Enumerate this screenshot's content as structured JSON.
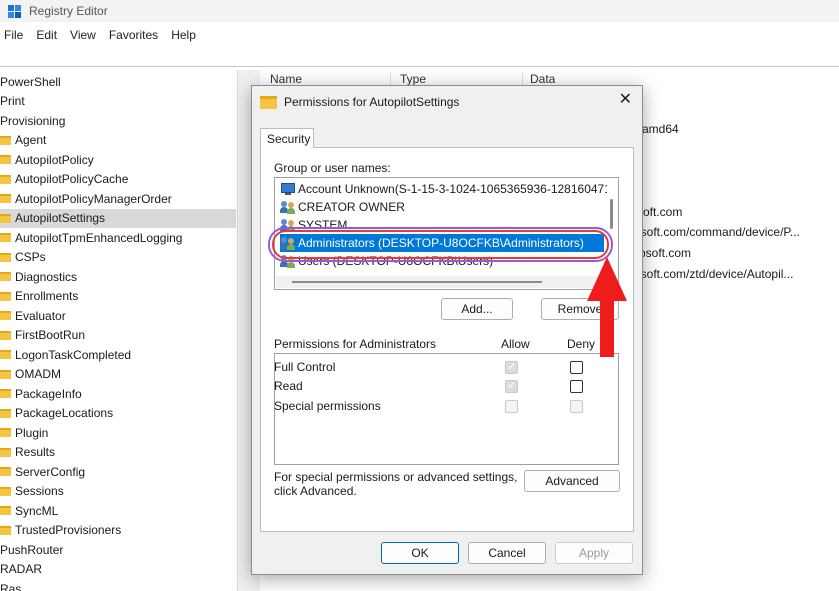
{
  "window": {
    "title": "Registry Editor"
  },
  "menu": [
    "File",
    "Edit",
    "View",
    "Favorites",
    "Help"
  ],
  "tree": {
    "items": [
      {
        "label": "PowerShell",
        "folder": false
      },
      {
        "label": "Print",
        "folder": false
      },
      {
        "label": "Provisioning",
        "folder": false
      },
      {
        "label": "Agent",
        "folder": true
      },
      {
        "label": "AutopilotPolicy",
        "folder": true
      },
      {
        "label": "AutopilotPolicyCache",
        "folder": true
      },
      {
        "label": "AutopilotPolicyManagerOrder",
        "folder": true
      },
      {
        "label": "AutopilotSettings",
        "folder": true,
        "selected": true
      },
      {
        "label": "AutopilotTpmEnhancedLogging",
        "folder": true
      },
      {
        "label": "CSPs",
        "folder": true
      },
      {
        "label": "Diagnostics",
        "folder": true
      },
      {
        "label": "Enrollments",
        "folder": true
      },
      {
        "label": "Evaluator",
        "folder": true
      },
      {
        "label": "FirstBootRun",
        "folder": true
      },
      {
        "label": "LogonTaskCompleted",
        "folder": true
      },
      {
        "label": "OMADM",
        "folder": true
      },
      {
        "label": "PackageInfo",
        "folder": true
      },
      {
        "label": "PackageLocations",
        "folder": true
      },
      {
        "label": "Plugin",
        "folder": true
      },
      {
        "label": "Results",
        "folder": true
      },
      {
        "label": "ServerConfig",
        "folder": true
      },
      {
        "label": "Sessions",
        "folder": true
      },
      {
        "label": "SyncML",
        "folder": true
      },
      {
        "label": "TrustedProvisioners",
        "folder": true
      },
      {
        "label": "PushRouter",
        "folder": false
      },
      {
        "label": "RADAR",
        "folder": false
      },
      {
        "label": "Ras",
        "folder": false
      }
    ]
  },
  "list": {
    "headers": [
      "Name",
      "Type",
      "Data"
    ],
    "data_cells": [
      "amd64",
      "oft.com",
      "osoft.com/command/device/P...",
      "rosoft.com",
      "osoft.com/ztd/device/Autopil..."
    ]
  },
  "dialog": {
    "title": "Permissions for AutopilotSettings",
    "close": "✕",
    "tab": "Security",
    "group_label": "Group or user names:",
    "users": [
      {
        "name": "Account Unknown(S-1-15-3-1024-1065365936-128160471",
        "icon": "pc"
      },
      {
        "name": "CREATOR OWNER",
        "icon": "users"
      },
      {
        "name": "SYSTEM",
        "icon": "users"
      },
      {
        "name": "Administrators (DESKTOP-U8OCFKB\\Administrators)",
        "icon": "users",
        "selected": true
      },
      {
        "name": "Users (DESKTOP-U8OCFKB\\Users)",
        "icon": "users"
      }
    ],
    "add_label": "Add...",
    "remove_label": "Remove",
    "perm_title": "Permissions for Administrators",
    "allow_label": "Allow",
    "deny_label": "Deny",
    "permissions": [
      {
        "name": "Full Control",
        "allow": true,
        "deny": false
      },
      {
        "name": "Read",
        "allow": true,
        "deny": false
      },
      {
        "name": "Special permissions",
        "allow": false,
        "deny": false
      }
    ],
    "advanced_text": "For special permissions or advanced settings, click Advanced.",
    "advanced_label": "Advanced",
    "ok_label": "OK",
    "cancel_label": "Cancel",
    "apply_label": "Apply"
  },
  "annotation_colors": {
    "arrow": "#ee1c1c",
    "ellipse_outer": "#9b59d6",
    "ellipse_inner": "#e33b3b",
    "selection": "#0078d7"
  }
}
